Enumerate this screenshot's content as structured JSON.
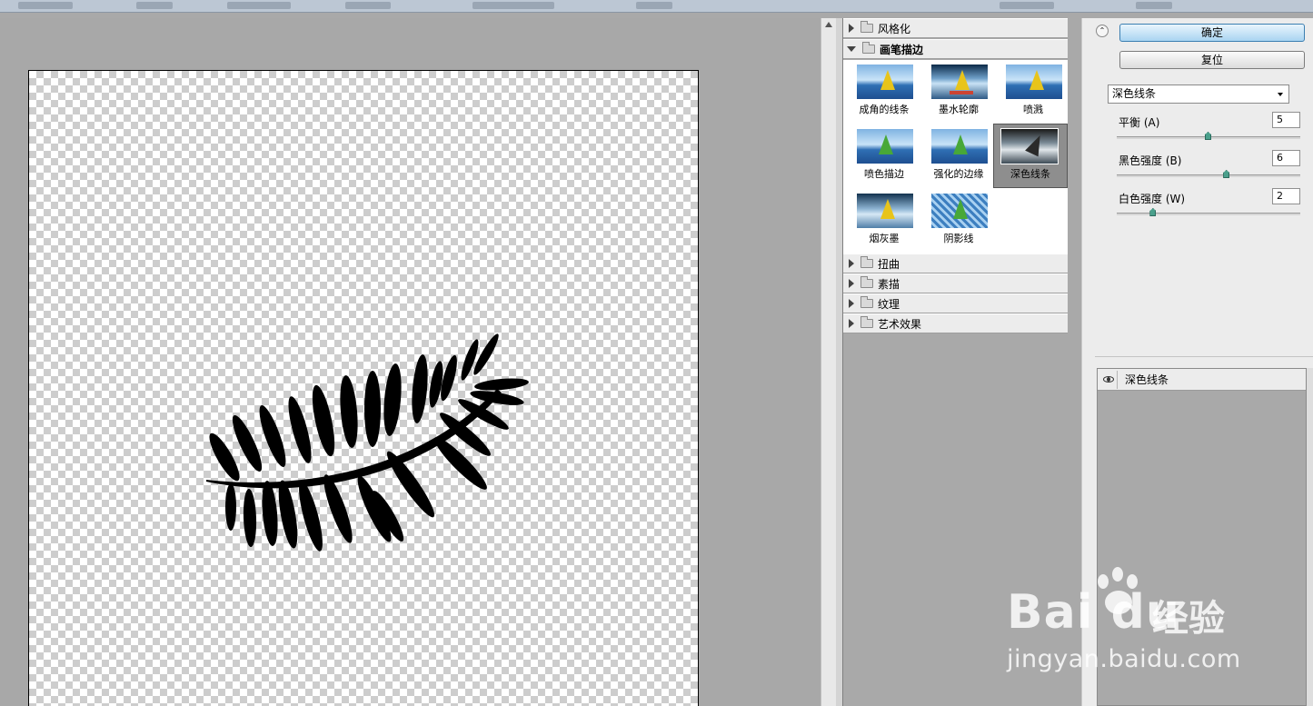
{
  "gallery": {
    "categories_top": [
      {
        "label": "风格化",
        "expanded": false
      }
    ],
    "active_category": {
      "label": "画笔描边",
      "expanded": true
    },
    "filters": [
      {
        "label": "成角的线条",
        "style": "sea",
        "selected": false
      },
      {
        "label": "墨水轮廓",
        "style": "dark",
        "selected": false
      },
      {
        "label": "喷溅",
        "style": "sea",
        "selected": false
      },
      {
        "label": "喷色描边",
        "style": "sea",
        "selected": false
      },
      {
        "label": "强化的边缘",
        "style": "sea",
        "selected": false
      },
      {
        "label": "深色线条",
        "style": "grey",
        "selected": true
      },
      {
        "label": "烟灰墨",
        "style": "blur",
        "selected": false
      },
      {
        "label": "阴影线",
        "style": "mesh",
        "selected": false
      }
    ],
    "categories_bottom": [
      {
        "label": "扭曲"
      },
      {
        "label": "素描"
      },
      {
        "label": "纹理"
      },
      {
        "label": "艺术效果"
      }
    ]
  },
  "settings": {
    "ok_label": "确定",
    "reset_label": "复位",
    "filter_select": "深色线条",
    "params": [
      {
        "label": "平衡 (A)",
        "value": "5",
        "fraction": 0.5
      },
      {
        "label": "黑色强度 (B)",
        "value": "6",
        "fraction": 0.6
      },
      {
        "label": "白色强度 (W)",
        "value": "2",
        "fraction": 0.2
      }
    ]
  },
  "layers": {
    "items": [
      {
        "label": "深色线条",
        "visible": true
      }
    ]
  },
  "watermark": {
    "logo": "Bai du",
    "brand": "经验",
    "url": "jingyan.baidu.com"
  },
  "colors": {
    "preview_bg": "#a8a8a8",
    "panel_bg": "#ececec",
    "primary_button": "#a9d4f1",
    "slider_knob": "#4aa08c"
  }
}
